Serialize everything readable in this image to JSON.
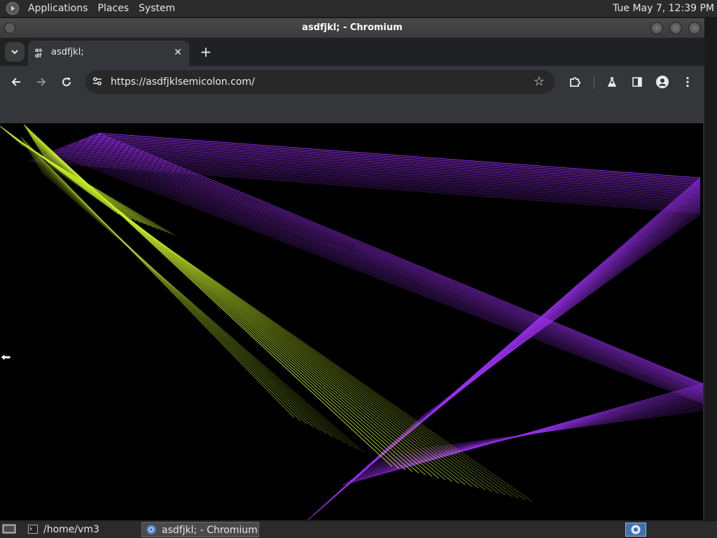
{
  "topbar": {
    "menus": [
      "Applications",
      "Places",
      "System"
    ],
    "clock": "Tue May  7, 12:39 PM"
  },
  "window": {
    "title": "asdfjkl; - Chromium"
  },
  "browser": {
    "tab": {
      "title": "asdfjkl;",
      "favicon_text": "as df",
      "close_label": "✕"
    },
    "new_tab_label": "+",
    "url": "https://asdfjklsemicolon.com/",
    "icons": {
      "back": "arrow-left-icon",
      "forward": "arrow-right-icon",
      "reload": "reload-icon",
      "site_info": "tune-icon",
      "bookmark": "star-icon",
      "extensions": "puzzle-icon",
      "labs": "flask-icon",
      "side_panel": "side-panel-icon",
      "profile": "person-icon",
      "menu": "kebab-menu-icon"
    }
  },
  "taskbar": {
    "items": [
      {
        "label": "/home/vm3",
        "icon": "terminal-icon"
      },
      {
        "label": "asdfjkl; - Chromium",
        "icon": "chromium-icon"
      }
    ]
  },
  "colors": {
    "canvas_bg": "#000000",
    "yellow_lines": "#c8f02a",
    "purple_lines": "#9b30f0"
  }
}
